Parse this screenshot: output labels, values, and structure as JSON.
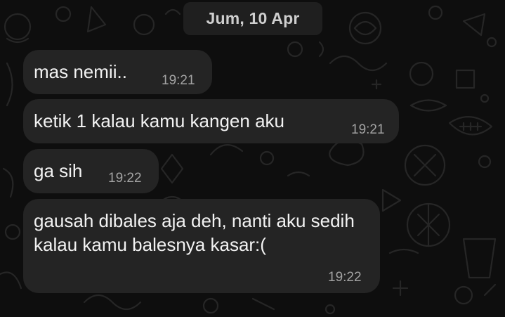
{
  "date_separator": "Jum, 10 Apr",
  "messages": [
    {
      "text": "mas nemii..",
      "time": "19:21"
    },
    {
      "text": "ketik 1 kalau kamu kangen aku",
      "time": "19:21"
    },
    {
      "text": "ga sih",
      "time": "19:22"
    },
    {
      "text": "gausah dibales aja deh, nanti aku sedih kalau kamu balesnya kasar:(",
      "time": "19:22"
    }
  ],
  "colors": {
    "background": "#0e0e0e",
    "bubble": "#242424",
    "text": "#f2f2f2",
    "timestamp": "#a3a3a3",
    "date_chip": "#1f1f1f"
  }
}
